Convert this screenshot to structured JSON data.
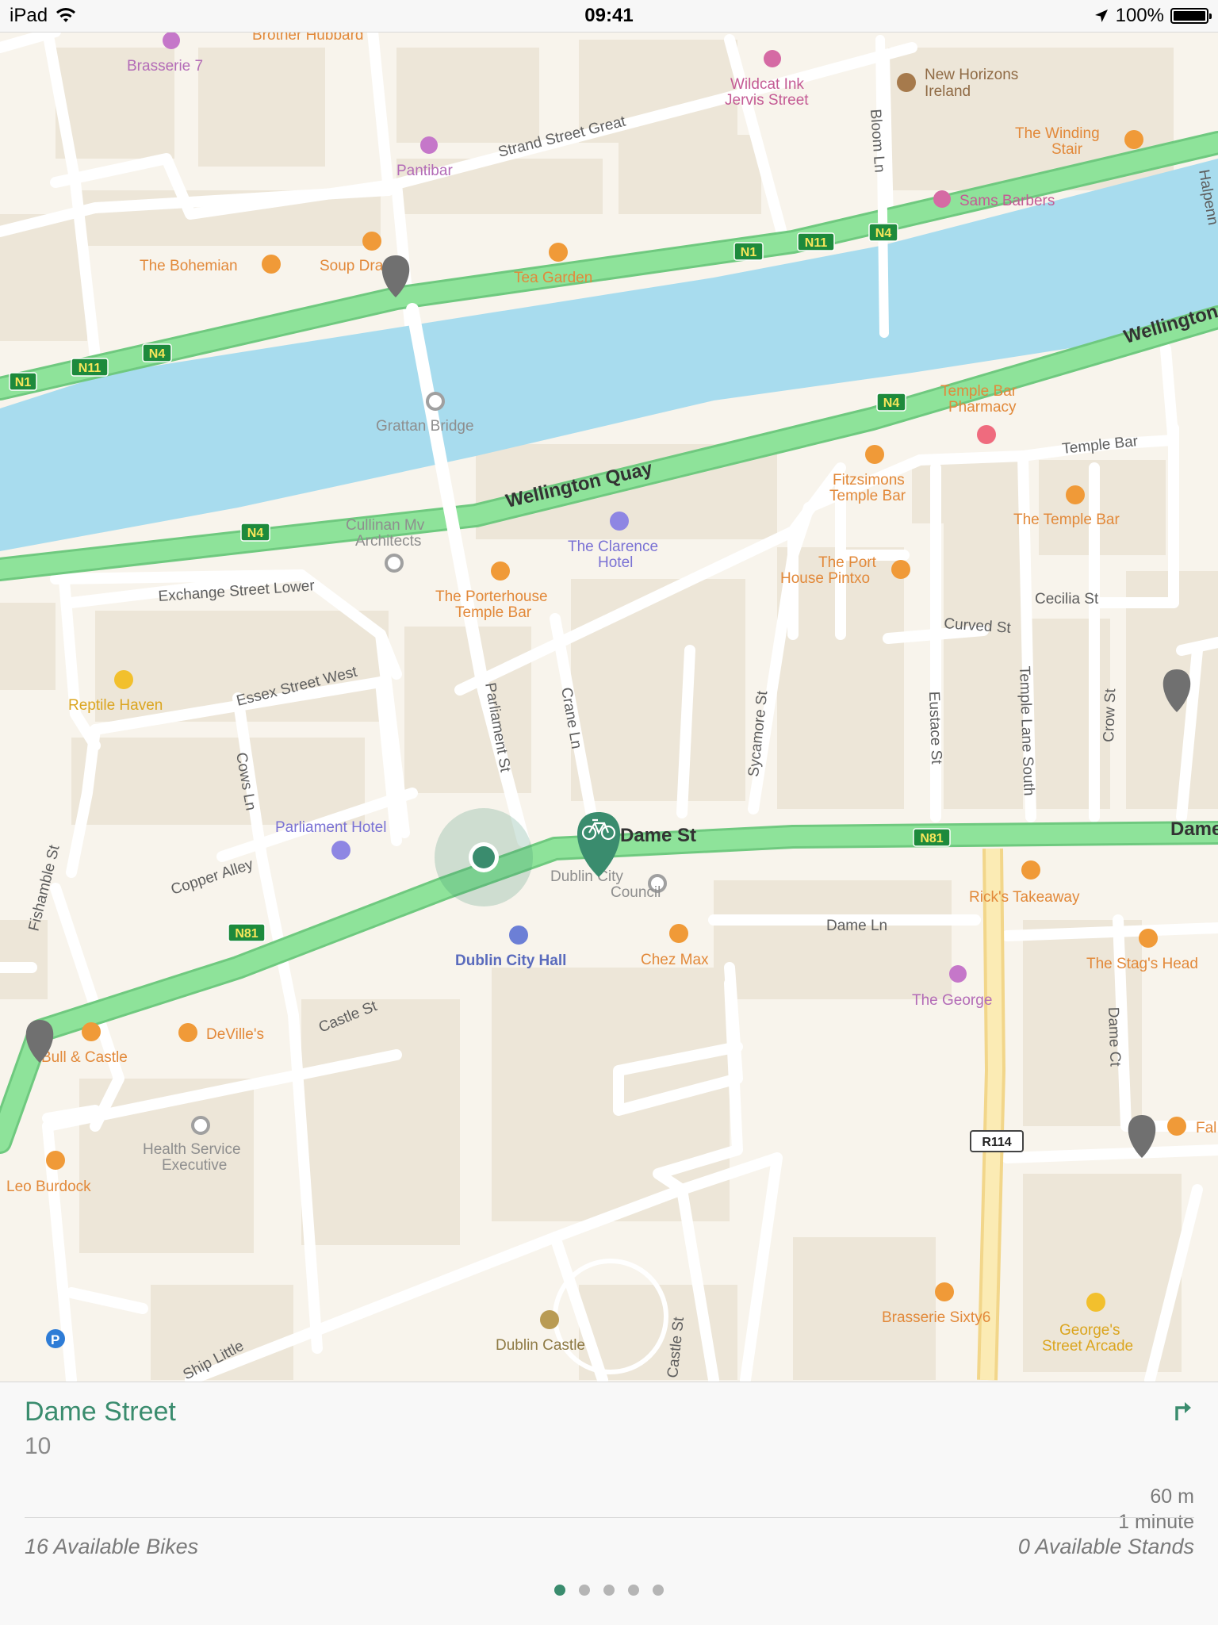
{
  "status_bar": {
    "device": "iPad",
    "time": "09:41",
    "battery": "100%",
    "battery_level": 1.0
  },
  "map": {
    "river_labels": {
      "wellington_quay": "Wellington Quay",
      "wellington_right": "Wellington"
    },
    "streets": {
      "strand_street_great": "Strand Street Great",
      "bloom_ln": "Bloom Ln",
      "temple_bar": "Temple Bar",
      "exchange_street_lower": "Exchange Street Lower",
      "essex_street_west": "Essex Street West",
      "parliament_st": "Parliament St",
      "crane_ln": "Crane Ln",
      "sycamore_st": "Sycamore St",
      "eustace_st": "Eustace St",
      "temple_lane_south": "Temple Lane South",
      "crow_st": "Crow St",
      "cecilia_st": "Cecilia St",
      "curved_st": "Curved St",
      "cows_ln": "Cows Ln",
      "copper_alley": "Copper Alley",
      "fishamble_st": "Fishamble St",
      "dame_st": "Dame St",
      "dame_right": "Dame",
      "dame_ln": "Dame Ln",
      "dame_ct": "Dame Ct",
      "castle_st": "Castle St",
      "castle_st_lower": "Castle St",
      "ship_little": "Ship Little",
      "halpenny": "Halpenn"
    },
    "road_shields": {
      "n1": "N1",
      "n11": "N11",
      "n4": "N4",
      "n81": "N81",
      "r114": "R114"
    },
    "pois": {
      "brother_hubbard": "Brother Hubbard",
      "brasserie_7": "Brasserie 7",
      "wildcat_ink": [
        "Wildcat Ink",
        "Jervis Street"
      ],
      "new_horizons": [
        "New Horizons",
        "Ireland"
      ],
      "pantibar": "Pantibar",
      "winding_stair": [
        "The Winding",
        "Stair"
      ],
      "sams_barbers": "Sams Barbers",
      "the_bohemian": "The Bohemian",
      "soup_dragon": "Soup Dragon",
      "tea_garden": "Tea Garden",
      "grattan_bridge": "Grattan Bridge",
      "temple_bar_pharmacy": [
        "Temple Bar",
        "Pharmacy"
      ],
      "fitzsimons": [
        "Fitzsimons",
        "Temple Bar"
      ],
      "the_temple_bar": "The Temple Bar",
      "cullinan": [
        "Cullinan Mv",
        "Architects"
      ],
      "clarence_hotel": [
        "The Clarence",
        "Hotel"
      ],
      "port_house": [
        "The Port",
        "House Pintxo"
      ],
      "porterhouse": [
        "The Porterhouse",
        "Temple Bar"
      ],
      "reptile_haven": "Reptile Haven",
      "parliament_hotel": "Parliament Hotel",
      "dublin_city_council": [
        "Dublin City",
        "Council"
      ],
      "ricks_takeaway": "Rick's Takeaway",
      "dublin_city_hall": "Dublin City Hall",
      "chez_max": "Chez Max",
      "stags_head": "The Stag's Head",
      "the_george": "The George",
      "bull_castle": "Bull & Castle",
      "devilles": "DeVille's",
      "health_service": [
        "Health Service",
        "Executive"
      ],
      "leo_burdock": "Leo Burdock",
      "fallon": "Fal",
      "brasserie_sixty6": "Brasserie Sixty6",
      "georges_arcade": [
        "George's",
        "Street Arcade"
      ],
      "dublin_castle": "Dublin Castle"
    }
  },
  "station_card": {
    "name": "Dame Street",
    "number": "10",
    "distance": "60 m",
    "duration": "1 minute",
    "available_bikes": "16 Available Bikes",
    "available_stands": "0 Available Stands"
  },
  "pager": {
    "pages": 5,
    "active": 0
  },
  "colors": {
    "accent": "#3a8c6e",
    "river": "#a8dcee",
    "highway": "#8ee39a",
    "poi_orange": "#f09a38",
    "poi_purple": "#c577c9",
    "poi_blue": "#6c7fd6",
    "marker_gray": "#707070"
  }
}
